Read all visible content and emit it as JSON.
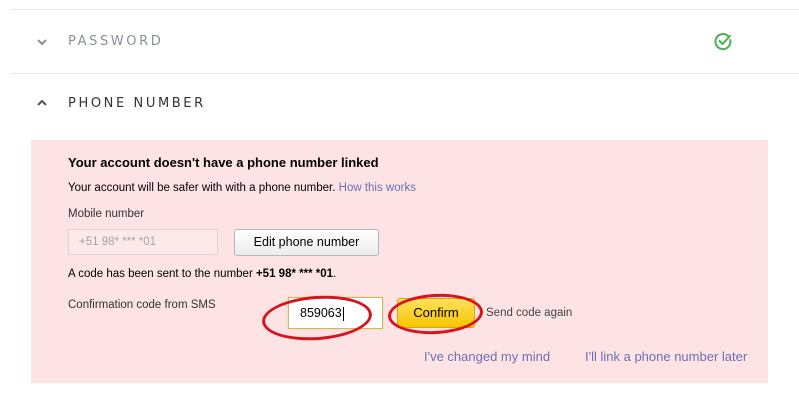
{
  "sections": {
    "password": {
      "title": "PASSWORD",
      "chevron_icon": "chevron-down-icon",
      "status_icon": "check-circle-icon",
      "status_color": "#4caf50"
    },
    "phone": {
      "title": "PHONE NUMBER",
      "chevron_icon": "chevron-up-icon"
    }
  },
  "panel": {
    "title": "Your account doesn't have a phone number linked",
    "subtitle": "Your account will be safer with with a phone number.",
    "how_link": "How this works",
    "mobile_label": "Mobile number",
    "mobile_value": "+51 98* *** *01",
    "edit_button": "Edit phone number",
    "code_sent_prefix": "A code has been sent to the number ",
    "code_sent_number": "+51 98* *** *01",
    "code_sent_suffix": ".",
    "confirm_label": "Confirmation code from SMS",
    "code_value": "859063",
    "confirm_button": "Confirm",
    "send_again": "Send code again",
    "changed_mind": "I've changed my mind",
    "link_later": "I'll link a phone number later",
    "background_color": "#fde3e4",
    "link_color": "#6b70b3",
    "confirm_color": "#f7c500",
    "annotation_color": "#d6141d"
  }
}
